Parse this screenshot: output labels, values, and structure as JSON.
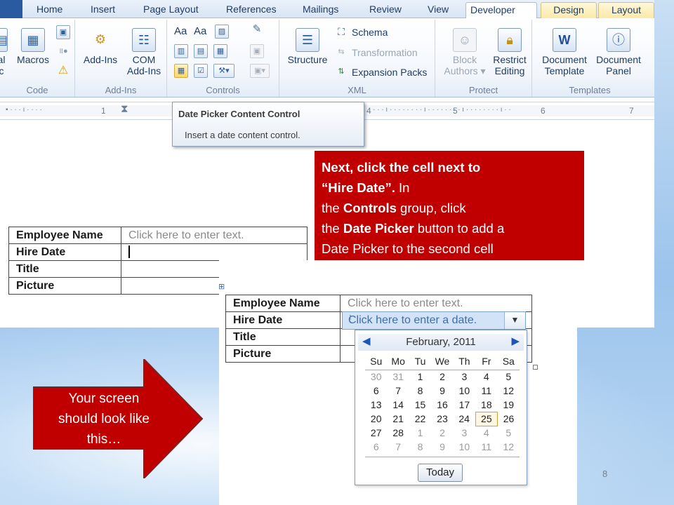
{
  "tabs": [
    "Home",
    "Insert",
    "Page Layout",
    "References",
    "Mailings",
    "Review",
    "View",
    "Developer",
    "Design",
    "Layout"
  ],
  "active_tab": "Developer",
  "ribbon": {
    "groups": {
      "code": "Code",
      "addins": "Add-Ins",
      "controls": "Controls",
      "xml": "XML",
      "protect": "Protect",
      "templates": "Templates"
    },
    "code_partial_label_1": "al",
    "code_partial_label_2": "c",
    "macros": "Macros",
    "addins": "Add-Ins",
    "com_addins_1": "COM",
    "com_addins_2": "Add-Ins",
    "structure": "Structure",
    "schema": "Schema",
    "transformation": "Transformation",
    "expansion_packs": "Expansion Packs",
    "block_authors_1": "Block",
    "block_authors_2": "Authors",
    "restrict_editing_1": "Restrict",
    "restrict_editing_2": "Editing",
    "document_template_1": "Document",
    "document_template_2": "Template",
    "document_panel_1": "Document",
    "document_panel_2": "Panel",
    "control_glyphs": {
      "rich_text": "Aa",
      "plain_text": "Aa"
    }
  },
  "ruler_numbers": [
    "1",
    "4",
    "5",
    "6",
    "7"
  ],
  "tooltip": {
    "title": "Date Picker Content Control",
    "body": "Insert a date content control."
  },
  "table_before": {
    "rows": [
      {
        "label": "Employee Name",
        "value": "Click here to enter text."
      },
      {
        "label": "Hire Date",
        "value": ""
      },
      {
        "label": "Title",
        "value": ""
      },
      {
        "label": "Picture",
        "value": ""
      }
    ]
  },
  "callout": {
    "line1": "Next, click the cell next to",
    "line2_bold": "“Hire Date”.",
    "line2_rest": " In",
    "line3_a": "the ",
    "line3_bold": "Controls",
    "line3_b": " group, click",
    "line4_a": "the ",
    "line4_bold": "Date Picker",
    "line4_b": " button  to add a",
    "line5": "Date Picker to the second cell"
  },
  "table_after": {
    "rows": [
      {
        "label": "Employee Name",
        "value": "Click here to enter text."
      },
      {
        "label": "Hire Date",
        "value": "Click here to enter a date."
      },
      {
        "label": "Title",
        "value": ""
      },
      {
        "label": "Picture",
        "value": ""
      }
    ]
  },
  "calendar": {
    "month": "February, 2011",
    "weekdays": [
      "Su",
      "Mo",
      "Tu",
      "We",
      "Th",
      "Fr",
      "Sa"
    ],
    "weeks": [
      [
        "30",
        "31",
        "1",
        "2",
        "3",
        "4",
        "5"
      ],
      [
        "6",
        "7",
        "8",
        "9",
        "10",
        "11",
        "12"
      ],
      [
        "13",
        "14",
        "15",
        "16",
        "17",
        "18",
        "19"
      ],
      [
        "20",
        "21",
        "22",
        "23",
        "24",
        "25",
        "26"
      ],
      [
        "27",
        "28",
        "1",
        "2",
        "3",
        "4",
        "5"
      ],
      [
        "6",
        "7",
        "8",
        "9",
        "10",
        "11",
        "12"
      ]
    ],
    "today": "25",
    "today_button": "Today"
  },
  "arrow_note": {
    "line1": "Your screen",
    "line2": "should look like",
    "line3": "this…"
  },
  "page_number": "8",
  "colors": {
    "callout_red": "#c00000",
    "ribbon_blue": "#1e3d66",
    "picker_highlight": "#d3e3f7"
  }
}
